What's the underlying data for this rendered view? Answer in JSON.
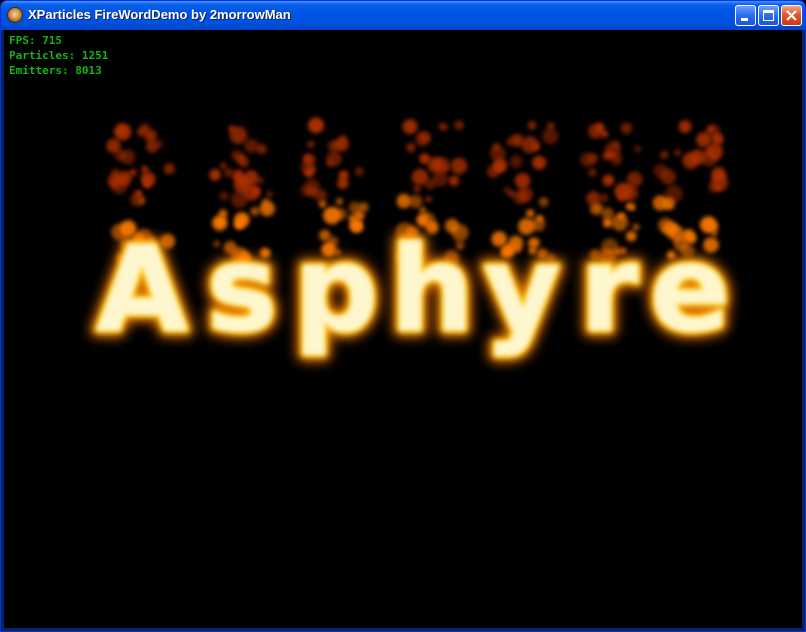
{
  "window": {
    "title": "XParticles FireWordDemo by 2morrowMan"
  },
  "hud": {
    "fps": "FPS: 715",
    "particles": "Particles: 1251",
    "emitters": "Emitters: 8013"
  },
  "scene": {
    "word": [
      "A",
      "s",
      "p",
      "h",
      "y",
      "r",
      "e"
    ],
    "colors": {
      "core": "#fffbe0",
      "mid": "#ffd21a",
      "outer": "#ff7a00",
      "ember": "#b03000"
    }
  },
  "icons": {
    "app": "app-icon",
    "minimize": "minimize-icon",
    "maximize": "maximize-icon",
    "close": "close-icon"
  }
}
